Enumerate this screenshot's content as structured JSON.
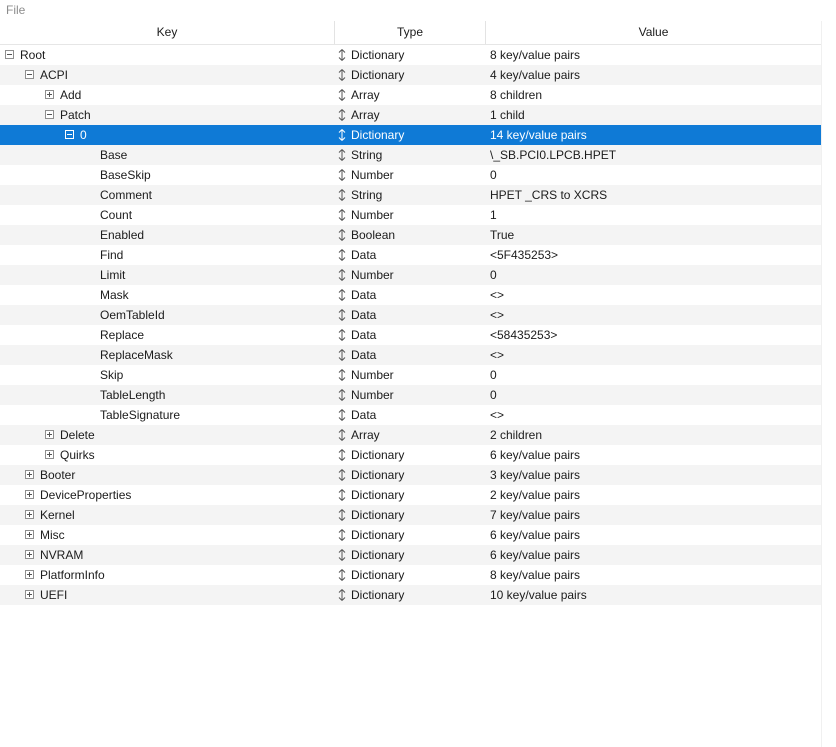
{
  "menu": {
    "file": "File"
  },
  "columns": {
    "key": "Key",
    "type": "Type",
    "value": "Value"
  },
  "rows": [
    {
      "key": "Root",
      "type": "Dictionary",
      "value": "8 key/value pairs",
      "level": 0,
      "expander": "minus"
    },
    {
      "key": "ACPI",
      "type": "Dictionary",
      "value": "4 key/value pairs",
      "level": 1,
      "expander": "minus"
    },
    {
      "key": "Add",
      "type": "Array",
      "value": "8 children",
      "level": 2,
      "expander": "plus"
    },
    {
      "key": "Patch",
      "type": "Array",
      "value": "1 child",
      "level": 2,
      "expander": "minus"
    },
    {
      "key": "0",
      "type": "Dictionary",
      "value": "14 key/value pairs",
      "level": 3,
      "expander": "minus",
      "selected": true
    },
    {
      "key": "Base",
      "type": "String",
      "value": "\\_SB.PCI0.LPCB.HPET",
      "level": 4,
      "expander": "none"
    },
    {
      "key": "BaseSkip",
      "type": "Number",
      "value": "0",
      "level": 4,
      "expander": "none"
    },
    {
      "key": "Comment",
      "type": "String",
      "value": "HPET _CRS to XCRS",
      "level": 4,
      "expander": "none"
    },
    {
      "key": "Count",
      "type": "Number",
      "value": "1",
      "level": 4,
      "expander": "none"
    },
    {
      "key": "Enabled",
      "type": "Boolean",
      "value": "True",
      "level": 4,
      "expander": "none"
    },
    {
      "key": "Find",
      "type": "Data",
      "value": "<5F435253>",
      "level": 4,
      "expander": "none"
    },
    {
      "key": "Limit",
      "type": "Number",
      "value": "0",
      "level": 4,
      "expander": "none"
    },
    {
      "key": "Mask",
      "type": "Data",
      "value": "<>",
      "level": 4,
      "expander": "none"
    },
    {
      "key": "OemTableId",
      "type": "Data",
      "value": "<>",
      "level": 4,
      "expander": "none"
    },
    {
      "key": "Replace",
      "type": "Data",
      "value": "<58435253>",
      "level": 4,
      "expander": "none"
    },
    {
      "key": "ReplaceMask",
      "type": "Data",
      "value": "<>",
      "level": 4,
      "expander": "none"
    },
    {
      "key": "Skip",
      "type": "Number",
      "value": "0",
      "level": 4,
      "expander": "none"
    },
    {
      "key": "TableLength",
      "type": "Number",
      "value": "0",
      "level": 4,
      "expander": "none"
    },
    {
      "key": "TableSignature",
      "type": "Data",
      "value": "<>",
      "level": 4,
      "expander": "none"
    },
    {
      "key": "Delete",
      "type": "Array",
      "value": "2 children",
      "level": 2,
      "expander": "plus"
    },
    {
      "key": "Quirks",
      "type": "Dictionary",
      "value": "6 key/value pairs",
      "level": 2,
      "expander": "plus"
    },
    {
      "key": "Booter",
      "type": "Dictionary",
      "value": "3 key/value pairs",
      "level": 1,
      "expander": "plus"
    },
    {
      "key": "DeviceProperties",
      "type": "Dictionary",
      "value": "2 key/value pairs",
      "level": 1,
      "expander": "plus"
    },
    {
      "key": "Kernel",
      "type": "Dictionary",
      "value": "7 key/value pairs",
      "level": 1,
      "expander": "plus"
    },
    {
      "key": "Misc",
      "type": "Dictionary",
      "value": "6 key/value pairs",
      "level": 1,
      "expander": "plus"
    },
    {
      "key": "NVRAM",
      "type": "Dictionary",
      "value": "6 key/value pairs",
      "level": 1,
      "expander": "plus"
    },
    {
      "key": "PlatformInfo",
      "type": "Dictionary",
      "value": "8 key/value pairs",
      "level": 1,
      "expander": "plus"
    },
    {
      "key": "UEFI",
      "type": "Dictionary",
      "value": "10 key/value pairs",
      "level": 1,
      "expander": "plus"
    }
  ],
  "icons": {
    "type_selector": "up-down-arrows-icon",
    "expand": "plus-box-icon",
    "collapse": "minus-box-icon"
  },
  "colors": {
    "selection": "#0f7ad6",
    "alt_row": "#f4f4f4",
    "menu_text": "#8c8c8c"
  }
}
